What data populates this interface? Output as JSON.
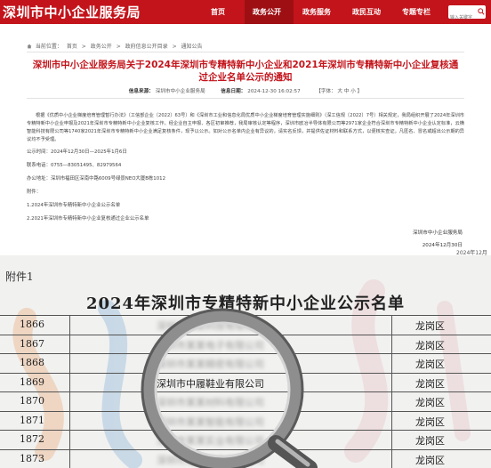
{
  "header": {
    "site_title": "深圳市中小企业服务局",
    "nav": [
      "首页",
      "政务公开",
      "政务服务",
      "政民互动",
      "专题专栏"
    ],
    "search_placeholder": "输入关键字"
  },
  "breadcrumb": {
    "prefix": "当前位置：",
    "items": [
      "首页",
      ">",
      "政务公开",
      ">",
      "政府信息公开目录",
      ">",
      "通知公告"
    ]
  },
  "article": {
    "title": "深圳市中小企业服务局关于2024年深圳市专精特新中小企业和2021年深圳市专精特新中小企业复核通过企业名单公示的通知",
    "meta": {
      "source_label": "信息来源：",
      "source": "深圳市中小企业服务局",
      "date_label": "信息日期：",
      "date": "2024-12-30 16:02:57",
      "font_label": "【字体：",
      "font_sizes": [
        "大",
        "中",
        "小"
      ],
      "font_close": "】"
    },
    "paragraph": "根据《优质中小企业梯度培育管理暂行办法》（工信部企业〔2022〕63号）和《深圳市工业和信息化局优质中小企业梯度培育管理实施细则》（深工信规〔2022〕7号）相关规定，我局组织开展了2024年深圳市专精特新中小企业申报及2021年深圳市专精特新中小企业复核工作。经企业自主申报、各区初审推荐，我局审核认定等程序，深圳市欧冶半导体有限公司等2971家企业符合深圳市专精特新中小企业认定标准，云横智能科技有限公司等1740家2021年深圳市专精特新中小企业满足复核条件，现予以公示。如对公示名单内企业有异议的，请实名反馈，并提供佐证材料和联系方式，以便核实查证。凡匿名、冒名或超出公示期的异议均不予受理。",
    "period": "公示时间：2024年12月30日—2025年1月6日",
    "phone": "联系电话：0755—83051495、82979564",
    "address": "办公地址：深圳市福田区深南中路6009号绿景NEO大厦B栋1012",
    "attachments_label": "附件：",
    "attachments": [
      "1.2024年深圳市专精特新中小企业公示名单",
      "2.2021年深圳市专精特新中小企业复核通过企业公示名单"
    ],
    "sign_org": "深圳市中小企业服务局",
    "sign_date": "2024年12月30日",
    "stray_date": "2024年12月"
  },
  "scan": {
    "attachment_label": "附件1",
    "table_title": "2024年深圳市专精特新中小企业公示名单",
    "rows": [
      {
        "num": "1866",
        "name": "深圳市某某科技有限公司",
        "district": "龙岗区",
        "clear": false
      },
      {
        "num": "1867",
        "name": "深圳市某某电子有限公司",
        "district": "龙岗区",
        "clear": false
      },
      {
        "num": "1868",
        "name": "深圳市某某精密有限公司",
        "district": "龙岗区",
        "clear": false
      },
      {
        "num": "1869",
        "name": "深圳市中履鞋业有限公司",
        "district": "龙岗区",
        "clear": true
      },
      {
        "num": "1870",
        "name": "深圳市某某材料有限公司",
        "district": "龙岗区",
        "clear": false
      },
      {
        "num": "1871",
        "name": "深圳市某某智能有限公司",
        "district": "龙岗区",
        "clear": false
      },
      {
        "num": "1872",
        "name": "深圳市某某实业有限公司",
        "district": "龙岗区",
        "clear": false
      },
      {
        "num": "1873",
        "name": "深圳市某某技术有限公司",
        "district": "龙岗区",
        "clear": false
      }
    ]
  },
  "colors": {
    "brand_red": "#c3141b",
    "nav_active": "#9e0f14"
  }
}
